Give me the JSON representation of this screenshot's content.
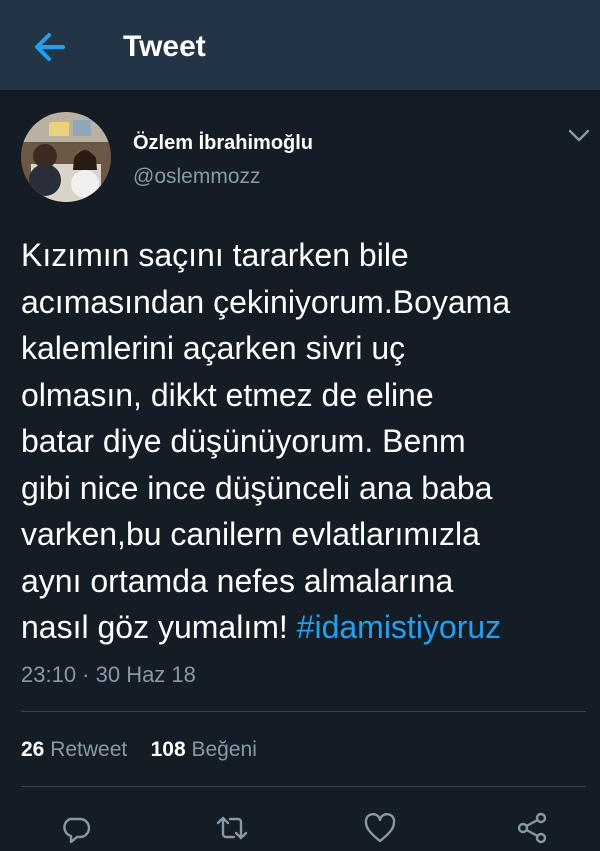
{
  "header": {
    "back_icon": "arrow-left-icon",
    "title": "Tweet"
  },
  "tweet": {
    "display_name": "Özlem İbrahimoğlu",
    "username": "@oslemmozz",
    "text_lines": [
      "Kızımın saçını tararken bile",
      "acımasından çekiniyorum.Boyama",
      "kalemlerini açarken sivri uç",
      "olmasın, dikkt etmez de eline",
      "batar diye düşünüyorum. Benm",
      "gibi nice ince düşünceli ana baba",
      "varken,bu canilern evlatlarımızla",
      "aynı ortamda nefes almalarına",
      "nasıl göz yumalım! "
    ],
    "hashtag": "#idamistiyoruz",
    "timestamp": "23:10 · 30 Haz 18"
  },
  "stats": {
    "retweet_count": "26",
    "retweet_label": "Retweet",
    "like_count": "108",
    "like_label": "Beğeni"
  },
  "actions": {
    "reply_icon": "reply-icon",
    "retweet_icon": "retweet-icon",
    "like_icon": "heart-icon",
    "share_icon": "share-icon"
  },
  "colors": {
    "background": "#141d26",
    "header_background": "#243447",
    "accent": "#1da1f2",
    "secondary_text": "#8899a6",
    "divider": "#38444d"
  }
}
